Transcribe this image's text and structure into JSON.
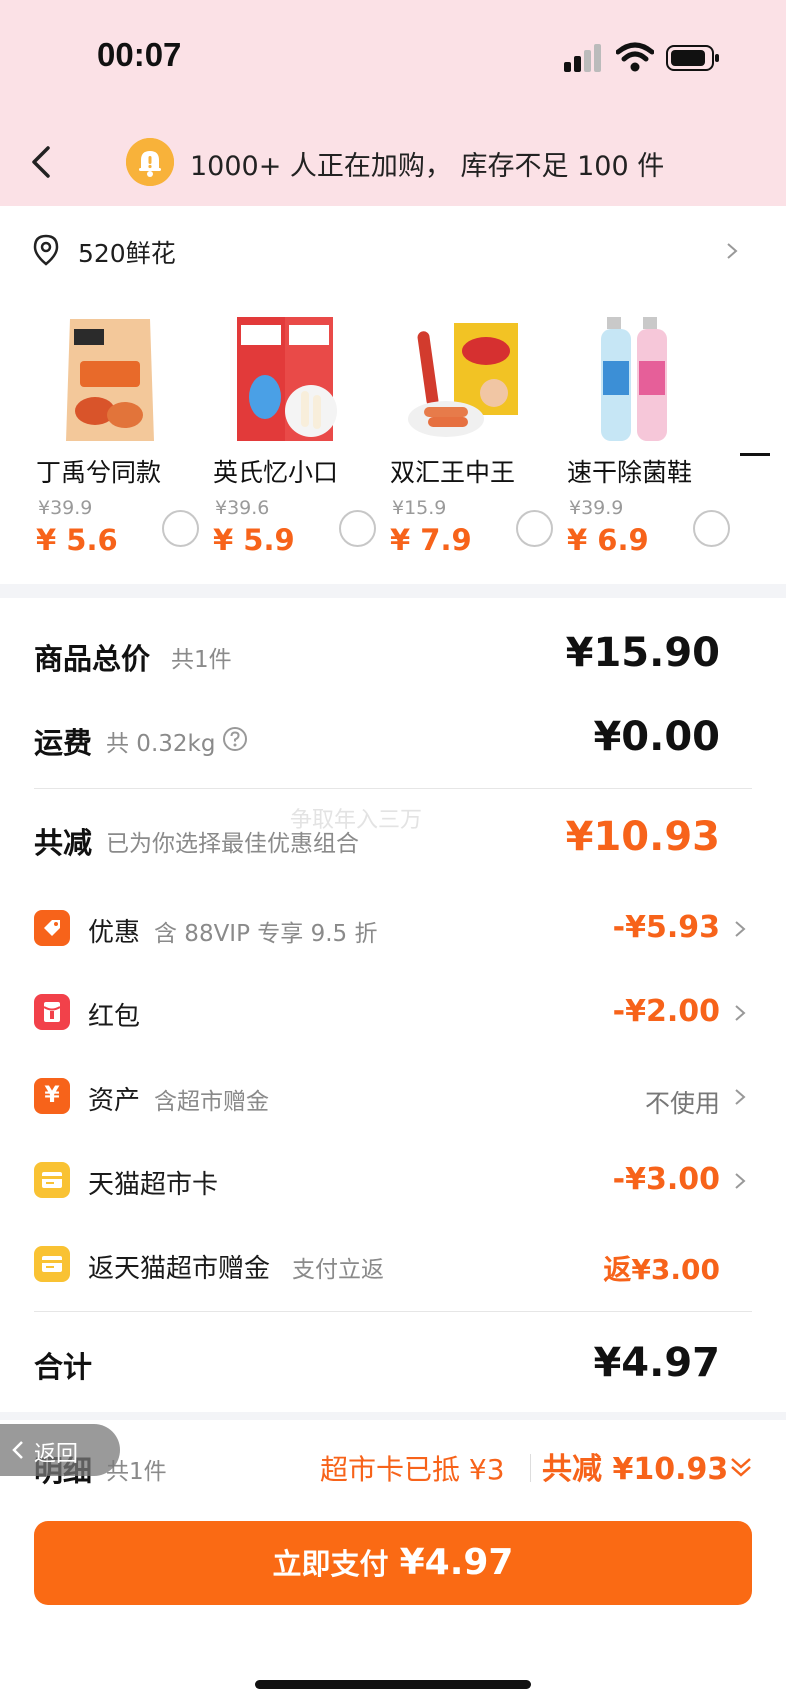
{
  "status": {
    "time": "00:07"
  },
  "header": {
    "notice": "1000+ 人正在加购， 库存不足 100 件"
  },
  "address": {
    "text": "520鲜花"
  },
  "products": [
    {
      "name": "丁禹兮同款",
      "orig": "¥39.9",
      "price": "5.6"
    },
    {
      "name": "英氏忆小口",
      "orig": "¥39.6",
      "price": "5.9"
    },
    {
      "name": "双汇王中王",
      "orig": "¥15.9",
      "price": "7.9"
    },
    {
      "name": "速干除菌鞋",
      "orig": "¥39.9",
      "price": "6.9"
    }
  ],
  "summary": {
    "goods_total_label": "商品总价",
    "goods_count": "共1件",
    "goods_total": "¥15.90",
    "shipping_label": "运费",
    "shipping_weight": "共 0.32kg",
    "shipping_amount": "¥0.00",
    "discount_label": "共减",
    "discount_sub": "已为你选择最佳优惠组合",
    "discount_amount": "¥10.93",
    "total_label": "合计",
    "total_amount": "¥4.97"
  },
  "discounts": [
    {
      "label": "优惠",
      "sub": "含 88VIP 专享 9.5 折",
      "amount": "-¥5.93",
      "icon": "tag-icon",
      "color": "#f7631a"
    },
    {
      "label": "红包",
      "sub": "",
      "amount": "-¥2.00",
      "icon": "red-envelope-icon",
      "color": "#f2414a"
    },
    {
      "label": "资产",
      "sub": "含超市赠金",
      "amount": "不使用",
      "icon": "yen-icon",
      "color": "#f7631a"
    },
    {
      "label": "天猫超市卡",
      "sub": "",
      "amount": "-¥3.00",
      "icon": "card-icon",
      "color": "#f9c233"
    },
    {
      "label": "返天猫超市赠金",
      "sub": "支付立返",
      "amount": "返¥3.00",
      "icon": "card-icon",
      "color": "#f9c233"
    }
  ],
  "detail_bar": {
    "label": "明细",
    "count": "共1件",
    "card_used": "超市卡已抵 ¥3",
    "total_discount": "共减 ¥10.93"
  },
  "back_float": "返回",
  "pay_button": {
    "label": "立即支付",
    "amount": "¥4.97"
  },
  "watermark": "争取年入三万"
}
